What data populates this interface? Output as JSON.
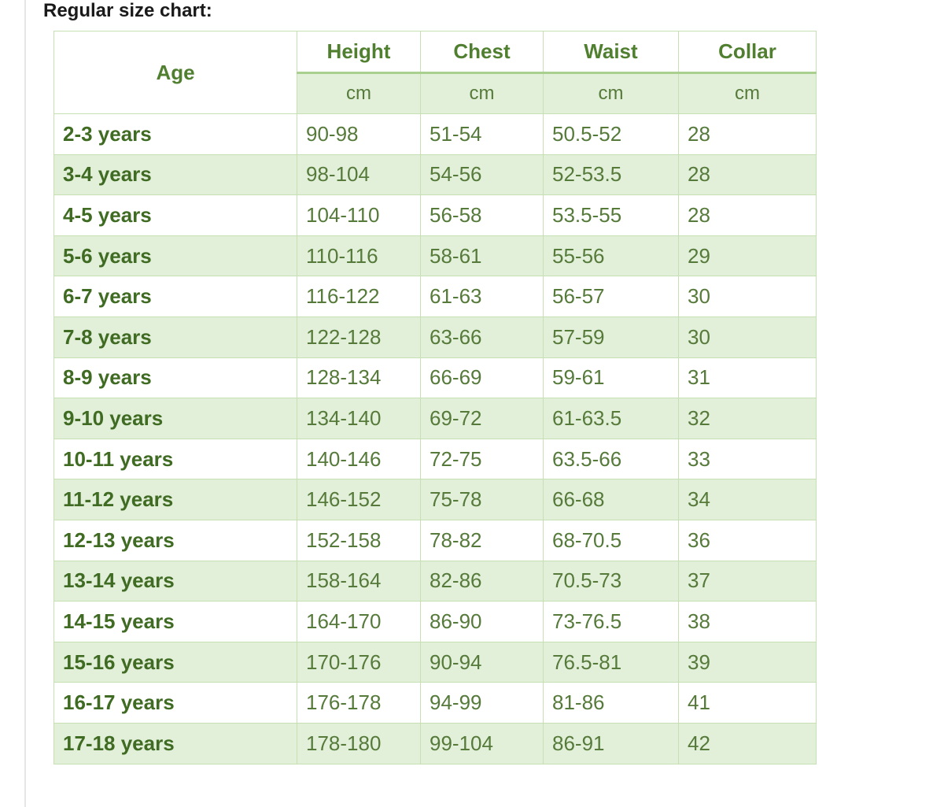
{
  "page": {
    "title": "Regular size chart:"
  },
  "table": {
    "headers": {
      "age": "Age",
      "height": "Height",
      "chest": "Chest",
      "waist": "Waist",
      "collar": "Collar"
    },
    "units": {
      "height": "cm",
      "chest": "cm",
      "waist": "cm",
      "collar": "cm"
    },
    "rows": [
      [
        "2-3 years",
        "90-98",
        "51-54",
        "50.5-52",
        "28"
      ],
      [
        "3-4 years",
        "98-104",
        "54-56",
        "52-53.5",
        "28"
      ],
      [
        "4-5 years",
        "104-110",
        "56-58",
        "53.5-55",
        "28"
      ],
      [
        "5-6 years",
        "110-116",
        "58-61",
        "55-56",
        "29"
      ],
      [
        "6-7 years",
        "116-122",
        "61-63",
        "56-57",
        "30"
      ],
      [
        "7-8 years",
        "122-128",
        "63-66",
        "57-59",
        "30"
      ],
      [
        "8-9 years",
        "128-134",
        "66-69",
        "59-61",
        "31"
      ],
      [
        "9-10 years",
        "134-140",
        "69-72",
        "61-63.5",
        "32"
      ],
      [
        "10-11 years",
        "140-146",
        "72-75",
        "63.5-66",
        "33"
      ],
      [
        "11-12 years",
        "146-152",
        "75-78",
        "66-68",
        "34"
      ],
      [
        "12-13 years",
        "152-158",
        "78-82",
        "68-70.5",
        "36"
      ],
      [
        "13-14 years",
        "158-164",
        "82-86",
        "70.5-73",
        "37"
      ],
      [
        "14-15 years",
        "164-170",
        "86-90",
        "73-76.5",
        "38"
      ],
      [
        "15-16 years",
        "170-176",
        "90-94",
        "76.5-81",
        "39"
      ],
      [
        "16-17 years",
        "176-178",
        "94-99",
        "81-86",
        "41"
      ],
      [
        "17-18 years",
        "178-180",
        "99-104",
        "86-91",
        "42"
      ]
    ]
  },
  "colors": {
    "header_text": "#4f7f2f",
    "body_text": "#557a3a",
    "stripe": "#e2efd9",
    "border": "#c6e0b4"
  }
}
